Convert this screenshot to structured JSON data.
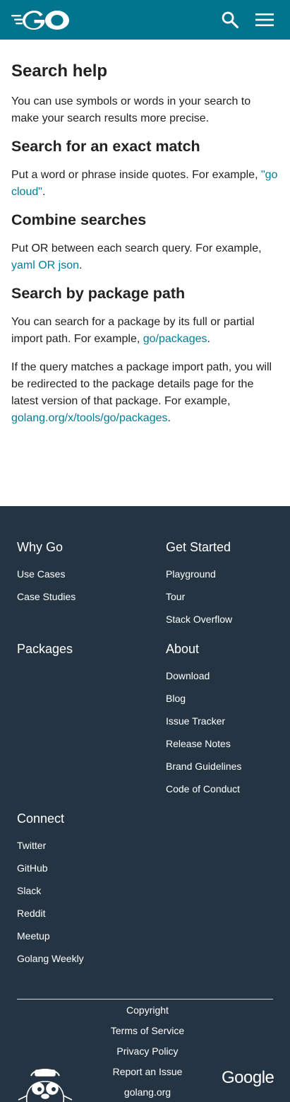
{
  "header": {
    "logo_alt": "Go",
    "search_icon": "search-icon",
    "menu_icon": "menu-icon"
  },
  "content": {
    "title": "Search help",
    "intro": "You can use symbols or words in your search to make your search results more precise.",
    "sections": [
      {
        "heading": "Search for an exact match",
        "text_before": "Put a word or phrase inside quotes. For example, ",
        "link": "\"go cloud\"",
        "text_after": "."
      },
      {
        "heading": "Combine searches",
        "text_before": "Put OR between each search query. For example, ",
        "link": "yaml OR json",
        "text_after": "."
      },
      {
        "heading": "Search by package path",
        "text_before": "You can search for a package by its full or partial import path. For example, ",
        "link": "go/packages",
        "text_after": "."
      }
    ],
    "redirect_text_before": "If the query matches a package import path, you will be redirected to the package details page for the latest version of that package. For example, ",
    "redirect_link": "golang.org/x/tools/go/packages",
    "redirect_text_after": "."
  },
  "footer": {
    "why_go": {
      "title": "Why Go",
      "links": [
        "Use Cases",
        "Case Studies"
      ]
    },
    "get_started": {
      "title": "Get Started",
      "links": [
        "Playground",
        "Tour",
        "Stack Overflow"
      ]
    },
    "packages": {
      "title": "Packages",
      "links": []
    },
    "about": {
      "title": "About",
      "links": [
        "Download",
        "Blog",
        "Issue Tracker",
        "Release Notes",
        "Brand Guidelines",
        "Code of Conduct"
      ]
    },
    "connect": {
      "title": "Connect",
      "links": [
        "Twitter",
        "GitHub",
        "Slack",
        "Reddit",
        "Meetup",
        "Golang Weekly"
      ]
    },
    "legal": [
      "Copyright",
      "Terms of Service",
      "Privacy Policy",
      "Report an Issue",
      "golang.org"
    ],
    "google_logo": "Google"
  },
  "colors": {
    "header_bg": "#00758d",
    "footer_bg": "#253443",
    "link": "#007d9c",
    "text": "#202224"
  }
}
